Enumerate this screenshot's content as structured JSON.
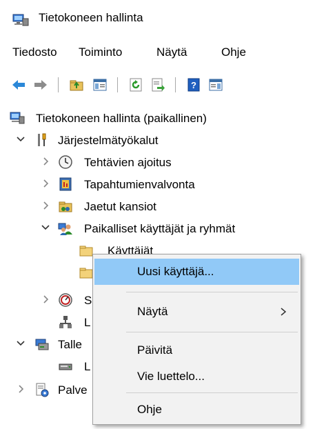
{
  "window": {
    "title": "Tietokoneen hallinta"
  },
  "menubar": {
    "items": [
      "Tiedosto",
      "Toiminto",
      "Näytä",
      "Ohje"
    ]
  },
  "toolbar": {
    "buttons": [
      "back-arrow-icon",
      "forward-arrow-icon",
      "up-folder-icon",
      "show-hide-tree-icon",
      "refresh-icon",
      "export-list-icon",
      "help-icon",
      "show-hide-action-pane-icon"
    ]
  },
  "tree": {
    "root": "Tietokoneen hallinta (paikallinen)",
    "system_tools": "Järjestelmätyökalut",
    "task_scheduler": "Tehtävien ajoitus",
    "event_viewer": "Tapahtumienvalvonta",
    "shared_folders": "Jaetut kansiot",
    "local_users_groups": "Paikalliset käyttäjät ja ryhmät",
    "users": "Käyttäjät",
    "groups": "",
    "performance": "S",
    "device_manager": "L",
    "storage": "Talle",
    "disk_mgmt": "L",
    "services": "Palve"
  },
  "context_menu": {
    "new_user": "Uusi käyttäjä...",
    "view": "Näytä",
    "refresh": "Päivitä",
    "export": "Vie luettelo...",
    "help": "Ohje"
  },
  "colors": {
    "highlight": "#91c9f7",
    "menu_bg": "#f2f2f2",
    "back_arrow": "#2b88d8"
  }
}
